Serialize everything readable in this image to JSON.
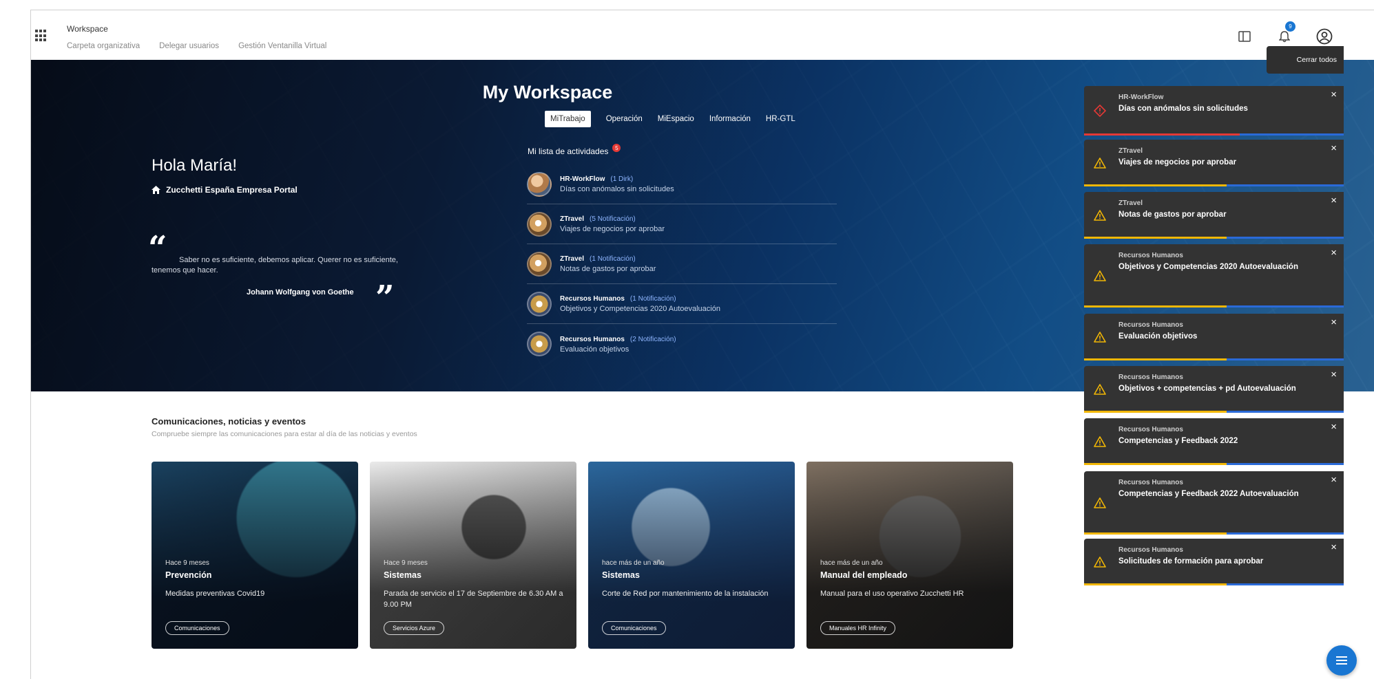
{
  "header": {
    "app_title": "Workspace",
    "nav": [
      "Carpeta organizativa",
      "Delegar usuarios",
      "Gestión Ventanilla Virtual"
    ],
    "notification_count": "9"
  },
  "hero": {
    "title": "My Workspace",
    "tabs": [
      "MiTrabajo",
      "Operación",
      "MiEspacio",
      "Información",
      "HR-GTL"
    ],
    "greeting": "Hola María!",
    "portal": "Zucchetti España Empresa Portal",
    "quote": "Saber no es suficiente, debemos aplicar. Querer no es suficiente, tenemos que hacer.",
    "quote_author": "Johann Wolfgang von Goethe",
    "activities_title": "Mi lista de actividades",
    "activities_badge": "5",
    "activities": [
      {
        "source": "HR-WorkFlow",
        "count": "(1 Dirk)",
        "desc": "Días con anómalos sin solicitudes"
      },
      {
        "source": "ZTravel",
        "count": "(5 Notificación)",
        "desc": "Viajes de negocios por aprobar"
      },
      {
        "source": "ZTravel",
        "count": "(1 Notificación)",
        "desc": "Notas de gastos por aprobar"
      },
      {
        "source": "Recursos Humanos",
        "count": "(1 Notificación)",
        "desc": "Objetivos y Competencias 2020 Autoevaluación"
      },
      {
        "source": "Recursos Humanos",
        "count": "(2 Notificación)",
        "desc": "Evaluación objetivos"
      }
    ]
  },
  "news": {
    "title": "Comunicaciones, noticias y eventos",
    "subtitle": "Compruebe siempre las comunicaciones para estar al día de las noticias y eventos",
    "cards": [
      {
        "time": "Hace 9 meses",
        "category": "Prevención",
        "desc": "Medidas preventivas Covid19",
        "chip": "Comunicaciones"
      },
      {
        "time": "Hace 9 meses",
        "category": "Sistemas",
        "desc": "Parada de servicio el 17 de Septiembre de 6.30 AM a 9.00 PM",
        "chip": "Servicios Azure"
      },
      {
        "time": "hace más de un año",
        "category": "Sistemas",
        "desc": "Corte de Red por mantenimiento de la instalación",
        "chip": "Comunicaciones"
      },
      {
        "time": "hace más de un año",
        "category": "Manual del empleado",
        "desc": "Manual para el uso operativo Zucchetti HR",
        "chip": "Manuales HR Infinity"
      }
    ]
  },
  "notifications": {
    "close_all": "Cerrar todos",
    "items": [
      {
        "source": "HR-WorkFlow",
        "msg": "Días con anómalos sin solicitudes",
        "type": "error",
        "progress": 0.6
      },
      {
        "source": "ZTravel",
        "msg": "Viajes de negocios por aprobar",
        "type": "warning",
        "progress": 0.55
      },
      {
        "source": "ZTravel",
        "msg": "Notas de gastos por aprobar",
        "type": "warning",
        "progress": 0.55
      },
      {
        "source": "Recursos Humanos",
        "msg": "Objetivos y Competencias 2020 Autoevaluación",
        "type": "warning",
        "progress": 0.55
      },
      {
        "source": "Recursos Humanos",
        "msg": "Evaluación objetivos",
        "type": "warning",
        "progress": 0.55
      },
      {
        "source": "Recursos Humanos",
        "msg": "Objetivos + competencias + pd Autoevaluación",
        "type": "warning",
        "progress": 0.55
      },
      {
        "source": "Recursos Humanos",
        "msg": "Competencias y Feedback 2022",
        "type": "warning",
        "progress": 0.55
      },
      {
        "source": "Recursos Humanos",
        "msg": "Competencias y Feedback 2022 Autoevaluación",
        "type": "warning",
        "progress": 0.55
      },
      {
        "source": "Recursos Humanos",
        "msg": "Solicitudes de formación para aprobar",
        "type": "warning",
        "progress": 0.55
      }
    ]
  },
  "colors": {
    "accent": "#1976d2",
    "warning": "#f2b705",
    "error": "#e53935",
    "toast_bg": "#333333"
  },
  "icons": {
    "apps": "apps-grid-icon",
    "panel": "panel-icon",
    "bell": "bell-icon",
    "user": "user-circle-icon",
    "home": "home-icon",
    "warning": "warning-icon",
    "error": "error-diamond-icon",
    "close": "close-icon",
    "fab": "menu-icon"
  }
}
